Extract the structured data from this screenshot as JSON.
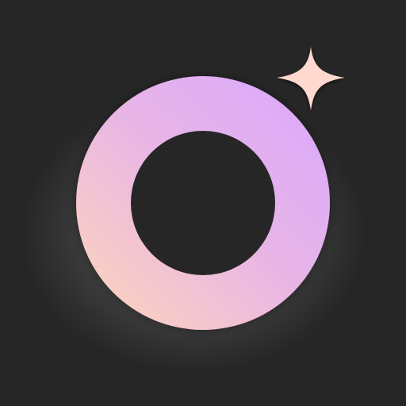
{
  "icon": {
    "background_color": "#262626",
    "shapes": [
      "ring-icon",
      "sparkle-icon"
    ],
    "ring": {
      "gradient_colors": [
        "#D9A8FF",
        "#E8B5E6",
        "#FFD7B8"
      ],
      "hole_color": "#262626"
    },
    "glow_color": "#D8D8D8",
    "sparkle_color": "#FFD9D0"
  }
}
